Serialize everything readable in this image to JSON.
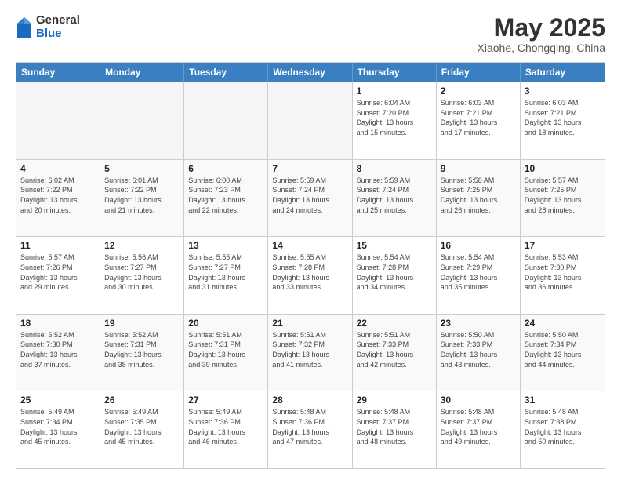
{
  "header": {
    "logo_general": "General",
    "logo_blue": "Blue",
    "month": "May 2025",
    "location": "Xiaohe, Chongqing, China"
  },
  "days_of_week": [
    "Sunday",
    "Monday",
    "Tuesday",
    "Wednesday",
    "Thursday",
    "Friday",
    "Saturday"
  ],
  "rows": [
    [
      {
        "day": "",
        "info": "",
        "empty": true
      },
      {
        "day": "",
        "info": "",
        "empty": true
      },
      {
        "day": "",
        "info": "",
        "empty": true
      },
      {
        "day": "",
        "info": "",
        "empty": true
      },
      {
        "day": "1",
        "info": "Sunrise: 6:04 AM\nSunset: 7:20 PM\nDaylight: 13 hours\nand 15 minutes."
      },
      {
        "day": "2",
        "info": "Sunrise: 6:03 AM\nSunset: 7:21 PM\nDaylight: 13 hours\nand 17 minutes."
      },
      {
        "day": "3",
        "info": "Sunrise: 6:03 AM\nSunset: 7:21 PM\nDaylight: 13 hours\nand 18 minutes."
      }
    ],
    [
      {
        "day": "4",
        "info": "Sunrise: 6:02 AM\nSunset: 7:22 PM\nDaylight: 13 hours\nand 20 minutes."
      },
      {
        "day": "5",
        "info": "Sunrise: 6:01 AM\nSunset: 7:22 PM\nDaylight: 13 hours\nand 21 minutes."
      },
      {
        "day": "6",
        "info": "Sunrise: 6:00 AM\nSunset: 7:23 PM\nDaylight: 13 hours\nand 22 minutes."
      },
      {
        "day": "7",
        "info": "Sunrise: 5:59 AM\nSunset: 7:24 PM\nDaylight: 13 hours\nand 24 minutes."
      },
      {
        "day": "8",
        "info": "Sunrise: 5:59 AM\nSunset: 7:24 PM\nDaylight: 13 hours\nand 25 minutes."
      },
      {
        "day": "9",
        "info": "Sunrise: 5:58 AM\nSunset: 7:25 PM\nDaylight: 13 hours\nand 26 minutes."
      },
      {
        "day": "10",
        "info": "Sunrise: 5:57 AM\nSunset: 7:25 PM\nDaylight: 13 hours\nand 28 minutes."
      }
    ],
    [
      {
        "day": "11",
        "info": "Sunrise: 5:57 AM\nSunset: 7:26 PM\nDaylight: 13 hours\nand 29 minutes."
      },
      {
        "day": "12",
        "info": "Sunrise: 5:56 AM\nSunset: 7:27 PM\nDaylight: 13 hours\nand 30 minutes."
      },
      {
        "day": "13",
        "info": "Sunrise: 5:55 AM\nSunset: 7:27 PM\nDaylight: 13 hours\nand 31 minutes."
      },
      {
        "day": "14",
        "info": "Sunrise: 5:55 AM\nSunset: 7:28 PM\nDaylight: 13 hours\nand 33 minutes."
      },
      {
        "day": "15",
        "info": "Sunrise: 5:54 AM\nSunset: 7:28 PM\nDaylight: 13 hours\nand 34 minutes."
      },
      {
        "day": "16",
        "info": "Sunrise: 5:54 AM\nSunset: 7:29 PM\nDaylight: 13 hours\nand 35 minutes."
      },
      {
        "day": "17",
        "info": "Sunrise: 5:53 AM\nSunset: 7:30 PM\nDaylight: 13 hours\nand 36 minutes."
      }
    ],
    [
      {
        "day": "18",
        "info": "Sunrise: 5:52 AM\nSunset: 7:30 PM\nDaylight: 13 hours\nand 37 minutes."
      },
      {
        "day": "19",
        "info": "Sunrise: 5:52 AM\nSunset: 7:31 PM\nDaylight: 13 hours\nand 38 minutes."
      },
      {
        "day": "20",
        "info": "Sunrise: 5:51 AM\nSunset: 7:31 PM\nDaylight: 13 hours\nand 39 minutes."
      },
      {
        "day": "21",
        "info": "Sunrise: 5:51 AM\nSunset: 7:32 PM\nDaylight: 13 hours\nand 41 minutes."
      },
      {
        "day": "22",
        "info": "Sunrise: 5:51 AM\nSunset: 7:33 PM\nDaylight: 13 hours\nand 42 minutes."
      },
      {
        "day": "23",
        "info": "Sunrise: 5:50 AM\nSunset: 7:33 PM\nDaylight: 13 hours\nand 43 minutes."
      },
      {
        "day": "24",
        "info": "Sunrise: 5:50 AM\nSunset: 7:34 PM\nDaylight: 13 hours\nand 44 minutes."
      }
    ],
    [
      {
        "day": "25",
        "info": "Sunrise: 5:49 AM\nSunset: 7:34 PM\nDaylight: 13 hours\nand 45 minutes."
      },
      {
        "day": "26",
        "info": "Sunrise: 5:49 AM\nSunset: 7:35 PM\nDaylight: 13 hours\nand 45 minutes."
      },
      {
        "day": "27",
        "info": "Sunrise: 5:49 AM\nSunset: 7:36 PM\nDaylight: 13 hours\nand 46 minutes."
      },
      {
        "day": "28",
        "info": "Sunrise: 5:48 AM\nSunset: 7:36 PM\nDaylight: 13 hours\nand 47 minutes."
      },
      {
        "day": "29",
        "info": "Sunrise: 5:48 AM\nSunset: 7:37 PM\nDaylight: 13 hours\nand 48 minutes."
      },
      {
        "day": "30",
        "info": "Sunrise: 5:48 AM\nSunset: 7:37 PM\nDaylight: 13 hours\nand 49 minutes."
      },
      {
        "day": "31",
        "info": "Sunrise: 5:48 AM\nSunset: 7:38 PM\nDaylight: 13 hours\nand 50 minutes."
      }
    ]
  ]
}
